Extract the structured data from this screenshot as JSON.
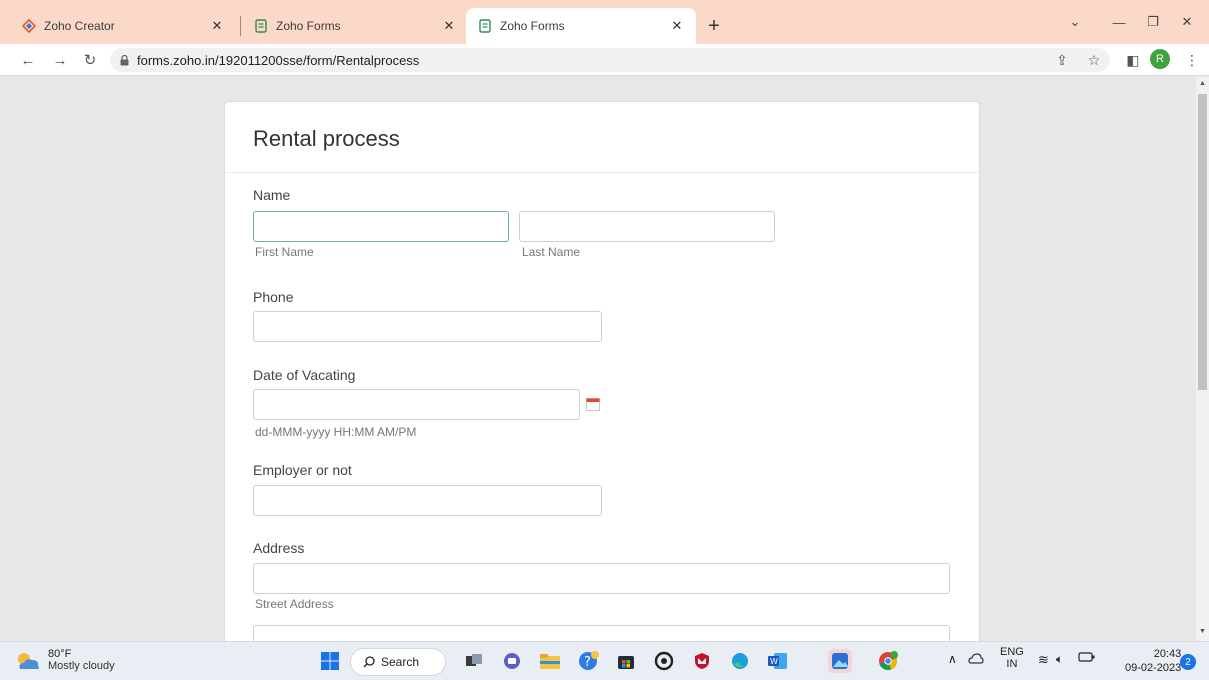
{
  "browser": {
    "tabs": [
      {
        "title": "Zoho Creator",
        "icon": "zoho-creator-icon",
        "active": false
      },
      {
        "title": "Zoho Forms",
        "icon": "zoho-forms-icon",
        "active": false
      },
      {
        "title": "Zoho Forms",
        "icon": "zoho-forms-icon",
        "active": true
      }
    ],
    "new_tab": "+",
    "url": "forms.zoho.in/192011200sse/form/Rentalprocess",
    "profile_initial": "R"
  },
  "form": {
    "title": "Rental process",
    "name": {
      "label": "Name",
      "first_sublabel": "First Name",
      "last_sublabel": "Last Name",
      "first_value": "",
      "last_value": ""
    },
    "phone": {
      "label": "Phone",
      "value": ""
    },
    "date_of_vacating": {
      "label": "Date of Vacating",
      "value": "",
      "format_hint": "dd-MMM-yyyy HH:MM AM/PM"
    },
    "employer": {
      "label": "Employer or not",
      "value": ""
    },
    "address": {
      "label": "Address",
      "street_sublabel": "Street Address",
      "street_value": "",
      "line2_value": ""
    }
  },
  "taskbar": {
    "weather_temp": "80°F",
    "weather_condition": "Mostly cloudy",
    "search_label": "Search",
    "language_line1": "ENG",
    "language_line2": "IN",
    "time": "20:43",
    "date": "09-02-2023",
    "notification_count": "2"
  },
  "colors": {
    "tab_strip": "#fbd9c8",
    "focus_border": "#66b3a6",
    "page_background": "#e8e8e8"
  }
}
